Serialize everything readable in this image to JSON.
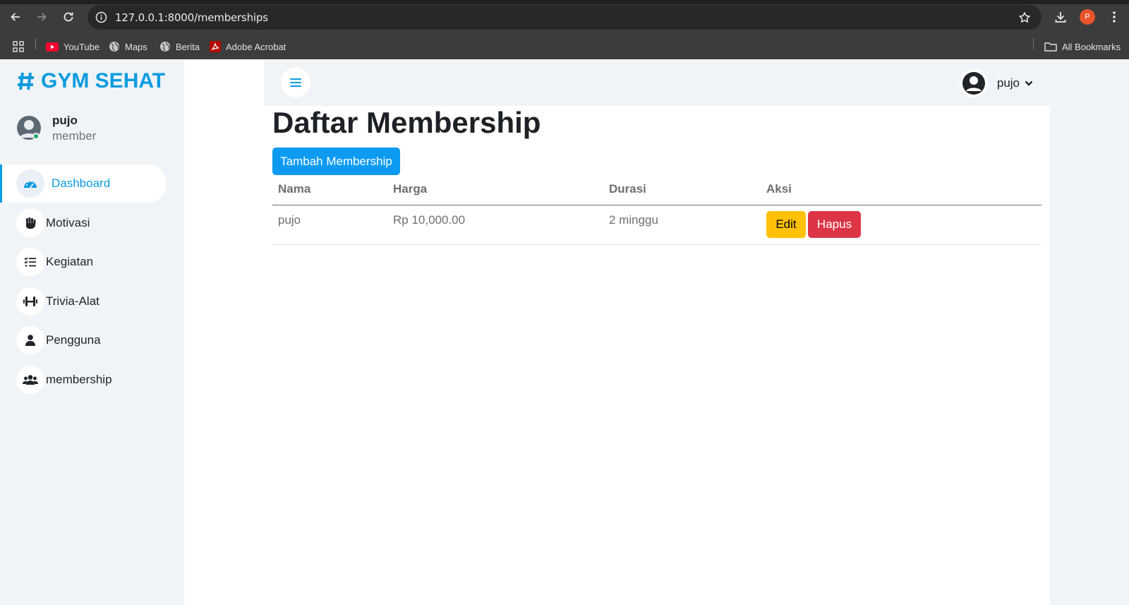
{
  "browser": {
    "url": "127.0.0.1:8000/memberships",
    "profile_initial": "P",
    "bookmarks": [
      {
        "label": "YouTube"
      },
      {
        "label": "Maps"
      },
      {
        "label": "Berita"
      },
      {
        "label": "Adobe Acrobat"
      }
    ],
    "all_bookmarks_label": "All Bookmarks"
  },
  "sidebar": {
    "brand": "GYM SEHAT",
    "user": {
      "name": "pujo",
      "role": "member"
    },
    "items": [
      {
        "label": "Dashboard",
        "icon": "gauge-icon",
        "active": true
      },
      {
        "label": "Motivasi",
        "icon": "fist-icon"
      },
      {
        "label": "Kegiatan",
        "icon": "checklist-icon"
      },
      {
        "label": "Trivia-Alat",
        "icon": "dumbbell-icon"
      },
      {
        "label": "Pengguna",
        "icon": "user-icon"
      },
      {
        "label": "membership",
        "icon": "users-icon"
      }
    ]
  },
  "topbar": {
    "username": "pujo"
  },
  "main": {
    "title": "Daftar Membership",
    "add_button": "Tambah Membership",
    "table": {
      "headers": [
        "Nama",
        "Harga",
        "Durasi",
        "Aksi"
      ],
      "rows": [
        {
          "nama": "pujo",
          "harga": "Rp 10,000.00",
          "durasi": "2 minggu"
        }
      ],
      "edit_label": "Edit",
      "delete_label": "Hapus"
    }
  },
  "colors": {
    "accent": "#0c9be0",
    "primary_button": "#0d9bf2",
    "warning": "#ffc107",
    "danger": "#dc3545",
    "sidebar_bg": "#f1f4f7"
  }
}
